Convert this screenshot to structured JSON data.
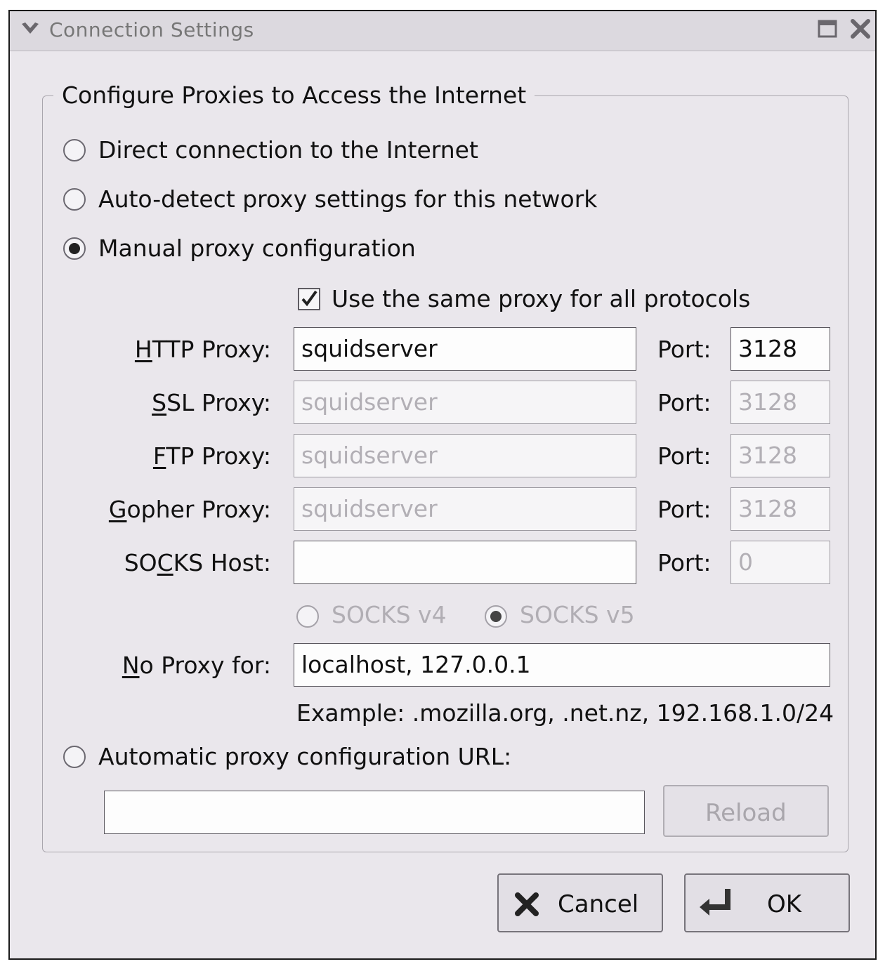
{
  "window": {
    "title": "Connection Settings"
  },
  "group": {
    "title": "Configure Proxies to Access the Internet"
  },
  "options": {
    "direct": "Direct connection to the Internet",
    "auto_detect": "Auto-detect proxy settings for this network",
    "manual": "Manual proxy configuration",
    "auto_url": "Automatic proxy configuration URL:",
    "selected": "manual"
  },
  "same_proxy": {
    "label": "Use the same proxy for all protocols",
    "checked": true
  },
  "proxies": {
    "http": {
      "label_u": "H",
      "label_rest": "TTP Proxy:",
      "value": "squidserver",
      "port_label": "Port:",
      "port": "3128"
    },
    "ssl": {
      "label_u": "S",
      "label_rest": "SL Proxy:",
      "value": "squidserver",
      "port_label": "Port:",
      "port": "3128"
    },
    "ftp": {
      "label_u": "F",
      "label_rest": "TP Proxy:",
      "value": "squidserver",
      "port_label": "Port:",
      "port": "3128"
    },
    "gopher": {
      "label_u": "G",
      "label_rest": "opher Proxy:",
      "value": "squidserver",
      "port_label": "Port:",
      "port": "3128"
    },
    "socks": {
      "label_pre": "SO",
      "label_u": "C",
      "label_rest": "KS Host:",
      "value": "",
      "port_label": "Port:",
      "port": "0"
    }
  },
  "socks_version": {
    "v4": "SOCKS v4",
    "v5": "SOCKS v5",
    "selected": "v5"
  },
  "no_proxy": {
    "label_u": "N",
    "label_rest": "o Proxy for:",
    "value": "localhost, 127.0.0.1",
    "example": "Example: .mozilla.org, .net.nz, 192.168.1.0/24"
  },
  "auto_url_value": "",
  "buttons": {
    "reload": "Reload",
    "cancel": "Cancel",
    "ok": "OK"
  }
}
